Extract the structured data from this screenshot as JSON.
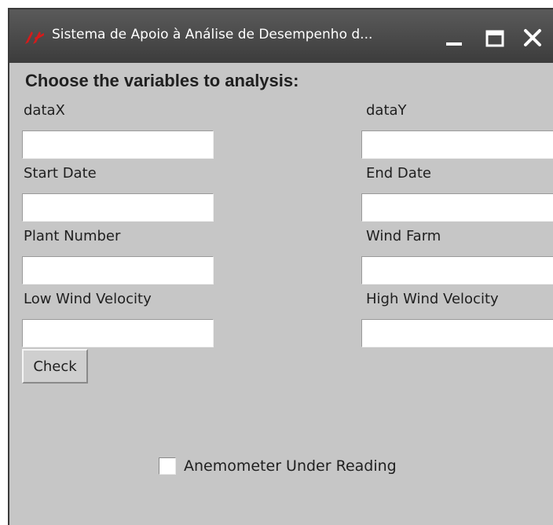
{
  "window": {
    "title": "Sistema de Apoio à Análise de Desempenho d...",
    "icon": "tk-feather-logo",
    "controls": [
      "minimize-icon",
      "maximize-icon",
      "close-icon"
    ]
  },
  "form": {
    "heading": "Choose the variables to analysis:",
    "fields": {
      "dataX": {
        "label": "dataX",
        "value": ""
      },
      "dataY": {
        "label": "dataY",
        "value": ""
      },
      "start_date": {
        "label": "Start Date",
        "value": ""
      },
      "end_date": {
        "label": "End Date",
        "value": ""
      },
      "plant_number": {
        "label": "Plant Number",
        "value": ""
      },
      "wind_farm": {
        "label": "Wind Farm",
        "value": ""
      },
      "low_wind_velocity": {
        "label": "Low Wind Velocity",
        "value": ""
      },
      "high_wind_velocity": {
        "label": "High Wind Velocity",
        "value": ""
      }
    },
    "check_button_label": "Check",
    "anemometer_checkbox": {
      "label": "Anemometer Under Reading",
      "checked": false
    }
  },
  "colors": {
    "titlebar": "#4a4a4a",
    "background": "#c6c6c6",
    "logo_red": "#d61a1a"
  }
}
